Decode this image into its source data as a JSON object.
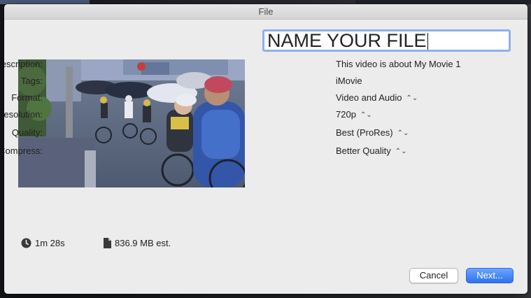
{
  "window": {
    "title": "File"
  },
  "name_field": {
    "value": "NAME YOUR FILE"
  },
  "details": [
    {
      "label": "Description:",
      "value": "This video is about My Movie 1",
      "popup": false
    },
    {
      "label": "Tags:",
      "value": "iMovie",
      "popup": false
    },
    {
      "label": "Format:",
      "value": "Video and Audio",
      "popup": true
    },
    {
      "label": "Resolution:",
      "value": "720p",
      "popup": true
    },
    {
      "label": "Quality:",
      "value": "Best (ProRes)",
      "popup": true
    },
    {
      "label": "Compress:",
      "value": "Better Quality",
      "popup": true
    }
  ],
  "stats": {
    "duration": "1m 28s",
    "size": "836.9 MB est."
  },
  "buttons": {
    "cancel": "Cancel",
    "next": "Next..."
  },
  "icons": {
    "duration": "clock-icon",
    "size": "document-icon",
    "popup": "up-down-chevron-icon"
  },
  "colors": {
    "accent": "#3b7df0",
    "focus_ring": "#8fb0ec",
    "window_bg": "#ececec"
  }
}
